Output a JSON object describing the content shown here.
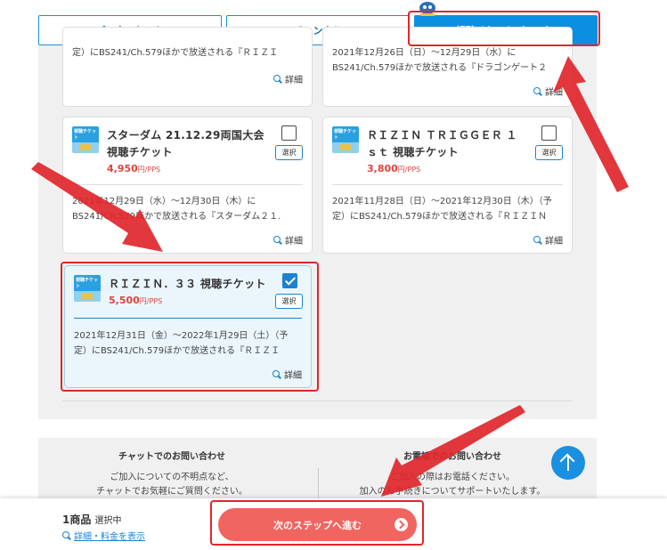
{
  "tabs": [
    {
      "label": "パック・セット",
      "active": false
    },
    {
      "label": "チャンネル",
      "active": false
    },
    {
      "label": "視聴チケット（PPS）",
      "active": true
    }
  ],
  "cards": [
    {
      "title": "",
      "price": "",
      "price_unit": "",
      "selected": false,
      "desc": [
        "定）にBS241/Ch.579ほかで放送される『ＲＩＺＩ"
      ],
      "detail": "詳細"
    },
    {
      "title": "",
      "price": "",
      "price_unit": "",
      "selected": false,
      "desc": [
        "2021年12月26日（日）～12月29日（水）に",
        "BS241/Ch.579ほかで放送される『ドラゴンゲート２"
      ],
      "detail": "詳細"
    },
    {
      "title": "スターダム 21.12.29両国大会 視聴チケット",
      "price": "4,950",
      "price_unit": "円/PPS",
      "selected": false,
      "select_label": "選択",
      "desc": [
        "2021年12月29日（水）～12月30日（木）に",
        "BS241/Ch.579ほかで放送される『スターダム２１."
      ],
      "detail": "詳細"
    },
    {
      "title": "ＲＩＺＩＮ ＴＲＩＧＧＥＲ １ｓｔ 視聴チケット",
      "price": "3,800",
      "price_unit": "円/PPS",
      "selected": false,
      "select_label": "選択",
      "desc": [
        "2021年11月28日（日）～2021年12月30日（木）（予",
        "定）にBS241/Ch.579ほかで放送される『ＲＩＺＩＮ"
      ],
      "detail": "詳細"
    },
    {
      "title": "ＲＩＺＩＮ．３３ 視聴チケット",
      "price": "5,500",
      "price_unit": "円/PPS",
      "selected": true,
      "select_label": "選択",
      "desc": [
        "2021年12月31日（金）～2022年1月29日（土）（予",
        "定）にBS241/Ch.579ほかで放送される『ＲＩＺＩ"
      ],
      "detail": "詳細"
    }
  ],
  "ticket_icon_text": "視聴チケット",
  "contact": {
    "chat": {
      "title": "チャットでのお問い合わせ",
      "lines": [
        "ご加入についての不明点など、",
        "チャットでお気軽にご質問ください。"
      ]
    },
    "phone": {
      "title": "お電話でのお問い合わせ",
      "lines": [
        "ご加入の際はお電話ください。",
        "加入のお手続きについてサポートいたします。"
      ]
    }
  },
  "bottom": {
    "count": "1商品",
    "count_suffix": "選択中",
    "detail_link": "詳細・料金を表示",
    "next_button": "次のステップへ進む"
  },
  "colors": {
    "accent": "#0a8fe2",
    "price": "#e0443c",
    "cta": "#f06560",
    "annotation": "#e0262b"
  }
}
